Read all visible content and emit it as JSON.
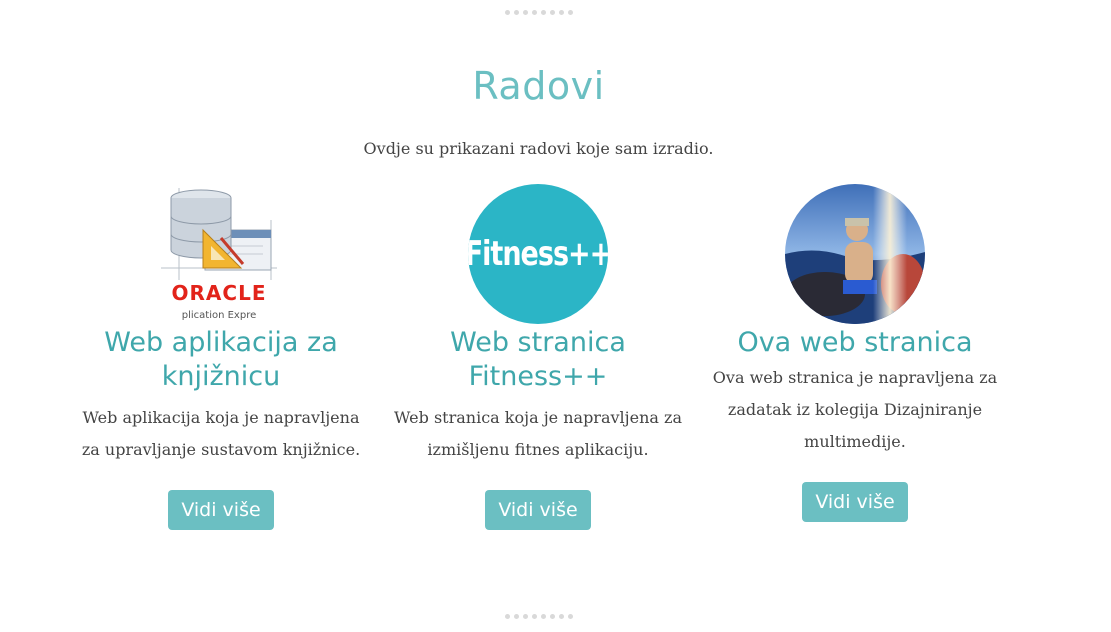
{
  "section": {
    "title": "Radovi",
    "subtitle": "Ovdje su prikazani radovi koje sam izradio."
  },
  "pagination_dots": 8,
  "projects": [
    {
      "image": "oracle-apex-database-icon",
      "logo_text": "ORACLE",
      "logo_subtext": "plication Expre",
      "title": "Web aplikacija za knjižnicu",
      "description": "Web aplikacija koja je napravljena za upravljanje sustavom knjižnice.",
      "button_label": "Vidi više"
    },
    {
      "image": "fitness-logo",
      "logo_text": "Fitness++",
      "title": "Web stranica Fitness++",
      "description": "Web stranica koja je napravljena za izmišljenu fitnes aplikaciju.",
      "button_label": "Vidi više"
    },
    {
      "image": "personal-photo",
      "title": "Ova web stranica",
      "description": "Ova web stranica je napravljena za zadatak iz kolegija Dizajniranje multimedije.",
      "button_label": "Vidi više"
    }
  ],
  "colors": {
    "accent": "#6bbfc2",
    "title": "#3fa7ab",
    "fitness_bg": "#2bb5c6",
    "oracle_red": "#e2231a"
  }
}
